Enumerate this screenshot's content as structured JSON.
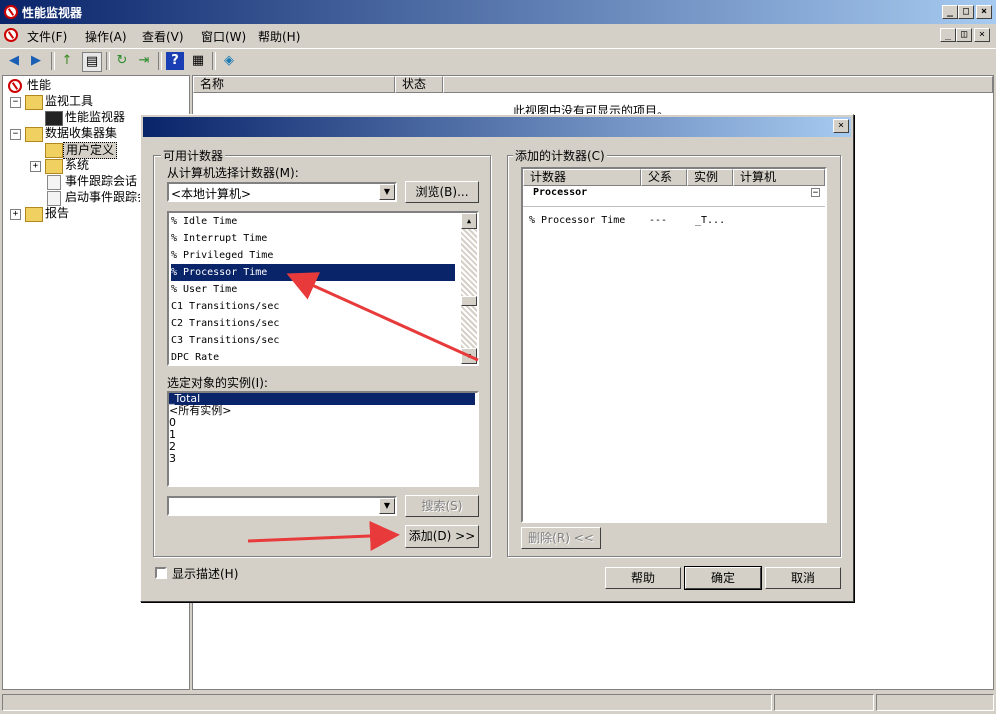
{
  "window": {
    "title": "性能监视器"
  },
  "menu": {
    "items": [
      "文件(F)",
      "操作(A)",
      "查看(V)",
      "窗口(W)",
      "帮助(H)"
    ]
  },
  "tree": {
    "root": "性能",
    "monitor_tools": "监视工具",
    "perf_monitor": "性能监视器",
    "data_collector_sets": "数据收集器集",
    "user_defined": "用户定义",
    "system": "系统",
    "event_trace": "事件跟踪会话",
    "startup_trace": "启动事件跟踪会",
    "reports": "报告"
  },
  "list": {
    "col_name": "名称",
    "col_status": "状态",
    "empty_text": "此视图中没有可显示的项目。"
  },
  "dialog": {
    "available_group": "可用计数器",
    "from_computer_label": "从计算机选择计数器(M):",
    "computer_value": "<本地计算机>",
    "browse_button": "浏览(B)...",
    "counters": [
      "% Idle Time",
      "% Interrupt Time",
      "% Privileged Time",
      "% Processor Time",
      "% User Time",
      "C1 Transitions/sec",
      "C2 Transitions/sec",
      "C3 Transitions/sec",
      "DPC Rate"
    ],
    "selected_counter": "% Processor Time",
    "instances_label": "选定对象的实例(I):",
    "instances": [
      "_Total",
      "<所有实例>",
      "0",
      "1",
      "2",
      "3"
    ],
    "selected_instance": "_Total",
    "search_button": "搜索(S)",
    "add_button": "添加(D) >>",
    "added_group": "添加的计数器(C)",
    "col_counter": "计数器",
    "col_parent": "父系",
    "col_instance": "实例",
    "col_computer": "计算机",
    "object_name": "Processor",
    "added_counter": "% Processor Time",
    "added_parent": "---",
    "added_instance": "_T...",
    "remove_button": "删除(R) <<",
    "show_description": "显示描述(H)",
    "show_description_checked": false,
    "help_button": "帮助",
    "ok_button": "确定",
    "cancel_button": "取消"
  },
  "annotation_color": "#e83a3a"
}
